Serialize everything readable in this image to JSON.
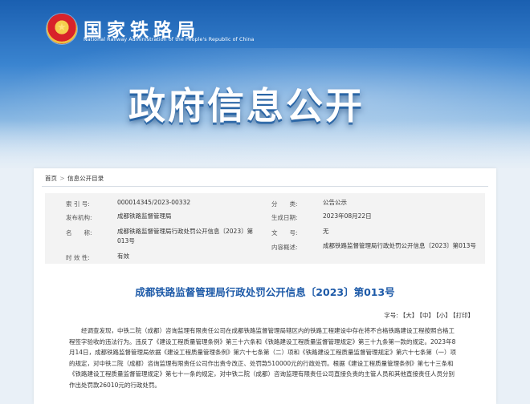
{
  "header": {
    "emblem_glyph": "★",
    "brand_cn": "国家铁路局",
    "brand_en": "National Railway Administration of the People's Republic of China",
    "hero_title": "政府信息公开"
  },
  "breadcrumb": {
    "home": "首页",
    "separator": ">",
    "current": "信息公开目录"
  },
  "meta": {
    "index_label": "索 引 号:",
    "index_value": "000014345/2023-00332",
    "category_label": "分　　类:",
    "category_value": "公告公示",
    "publisher_label": "发布机构:",
    "publisher_value": "成都铁路监督管理局",
    "date_label": "生成日期:",
    "date_value": "2023年08月22日",
    "name_label": "名　　称:",
    "name_value": "成都铁路监督管理局行政处罚公开信息〔2023〕第013号",
    "docno_label": "文　　号:",
    "docno_value": "无",
    "summary_label": "内容概述:",
    "summary_value": "成都铁路监督管理局行政处罚公开信息〔2023〕第013号",
    "validity_label": "时 效 性:",
    "validity_value": "有效"
  },
  "article": {
    "title": "成都铁路监督管理局行政处罚公开信息〔2023〕第013号",
    "fontsize_label": "字号:",
    "size_large": "【大】",
    "size_medium": "【中】",
    "size_small": "【小】",
    "print": "【打印】",
    "body": "经调查发现，中铁二院（成都）咨询监理有限责任公司在成都铁路监督管理局辖区内的铁路工程建设中存在将不合格铁路建设工程按照合格工程签字验收的违法行为。违反了《建设工程质量管理条例》第三十六条和《铁路建设工程质量监督管理规定》第三十九条第一款的规定。2023年8月14日，成都铁路监督管理局依据《建设工程质量管理条例》第六十七条第（二）项和《铁路建设工程质量监督管理规定》第六十七条第（一）项的规定，对中铁二院（成都）咨询监理有限责任公司作出责令改正、处罚款510000元的行政处罚。根据《建设工程质量管理条例》第七十三条和《铁路建设工程质量监督管理规定》第七十一条的规定，对中铁二院（成都）咨询监理有限责任公司直接负责的主管人员和其他直接责任人员分别作出处罚款26010元的行政处罚。"
  }
}
